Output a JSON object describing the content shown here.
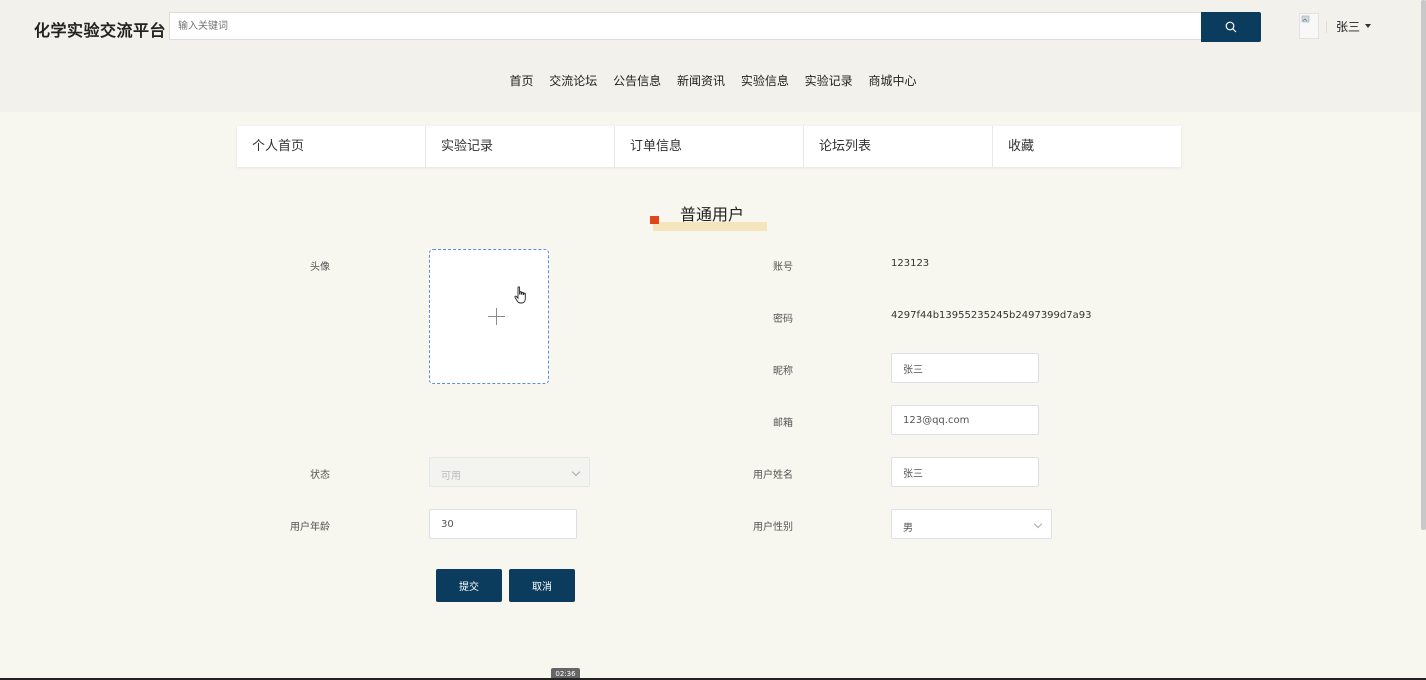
{
  "header": {
    "logo": "化学实验交流平台",
    "search_placeholder": "输入关键词",
    "user_name": "张三"
  },
  "nav": {
    "items": [
      "首页",
      "交流论坛",
      "公告信息",
      "新闻资讯",
      "实验信息",
      "实验记录",
      "商城中心"
    ]
  },
  "subnav": {
    "items": [
      "个人首页",
      "实验记录",
      "订单信息",
      "论坛列表",
      "收藏"
    ]
  },
  "form": {
    "title": "普通用户",
    "avatar_label": "头像",
    "account_label": "账号",
    "account_value": "123123",
    "password_label": "密码",
    "password_value": "4297f44b13955235245b2497399d7a93",
    "nickname_label": "昵称",
    "nickname_value": "张三",
    "email_label": "邮箱",
    "email_value": "123@qq.com",
    "status_label": "状态",
    "status_value": "可用",
    "realname_label": "用户姓名",
    "realname_value": "张三",
    "age_label": "用户年龄",
    "age_value": "30",
    "gender_label": "用户性别",
    "gender_value": "男",
    "submit_label": "提交",
    "cancel_label": "取消"
  },
  "video": {
    "timestamp": "02:36"
  },
  "colors": {
    "primary": "#0b3c5d",
    "accent": "#e0461a",
    "highlight": "#f5e5bc",
    "background": "#f7f6ef"
  }
}
